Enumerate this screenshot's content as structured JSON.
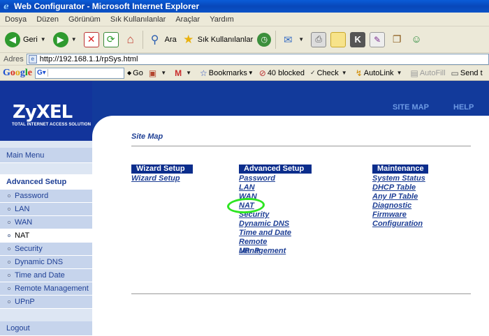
{
  "window": {
    "title": "Web Configurator - Microsoft Internet Explorer"
  },
  "menubar": {
    "items": [
      "Dosya",
      "Düzen",
      "Görünüm",
      "Sık Kullanılanlar",
      "Araçlar",
      "Yardım"
    ]
  },
  "toolbar": {
    "back_label": "Geri",
    "search_label": "Ara",
    "favorites_label": "Sık Kullanılanlar"
  },
  "address": {
    "label": "Adres",
    "url": "http://192.168.1.1/rpSys.html"
  },
  "google_bar": {
    "go_label": "Go",
    "bookmarks_label": "Bookmarks",
    "blocked_label": "40 blocked",
    "check_label": "Check",
    "autolink_label": "AutoLink",
    "autofill_label": "AutoFill",
    "send_label": "Send t"
  },
  "brand": {
    "logo": "ZyXEL",
    "tagline": "TOTAL INTERNET ACCESS SOLUTION"
  },
  "topnav": {
    "site_map": "SITE MAP",
    "help": "HELP"
  },
  "sidebar": {
    "main_menu": "Main Menu",
    "section": "Advanced Setup",
    "items": [
      "Password",
      "LAN",
      "WAN",
      "NAT",
      "Security",
      "Dynamic DNS",
      "Time and Date",
      "Remote Management",
      "UPnP"
    ],
    "selected": "NAT",
    "logout": "Logout"
  },
  "sitemap": {
    "title": "Site Map",
    "columns": [
      {
        "header": "Wizard Setup",
        "links": [
          "Wizard Setup"
        ]
      },
      {
        "header": "Advanced Setup",
        "links": [
          "Password",
          "LAN",
          "WAN",
          "NAT",
          "Security",
          "Dynamic DNS",
          "Time and Date",
          "Remote Management",
          "UPnP"
        ]
      },
      {
        "header": "Maintenance",
        "links": [
          "System Status",
          "DHCP Table",
          "Any IP Table",
          "Diagnostic",
          "Firmware",
          "Configuration"
        ]
      }
    ],
    "highlighted_link": "NAT",
    "highlight_color": "#2ee522"
  }
}
